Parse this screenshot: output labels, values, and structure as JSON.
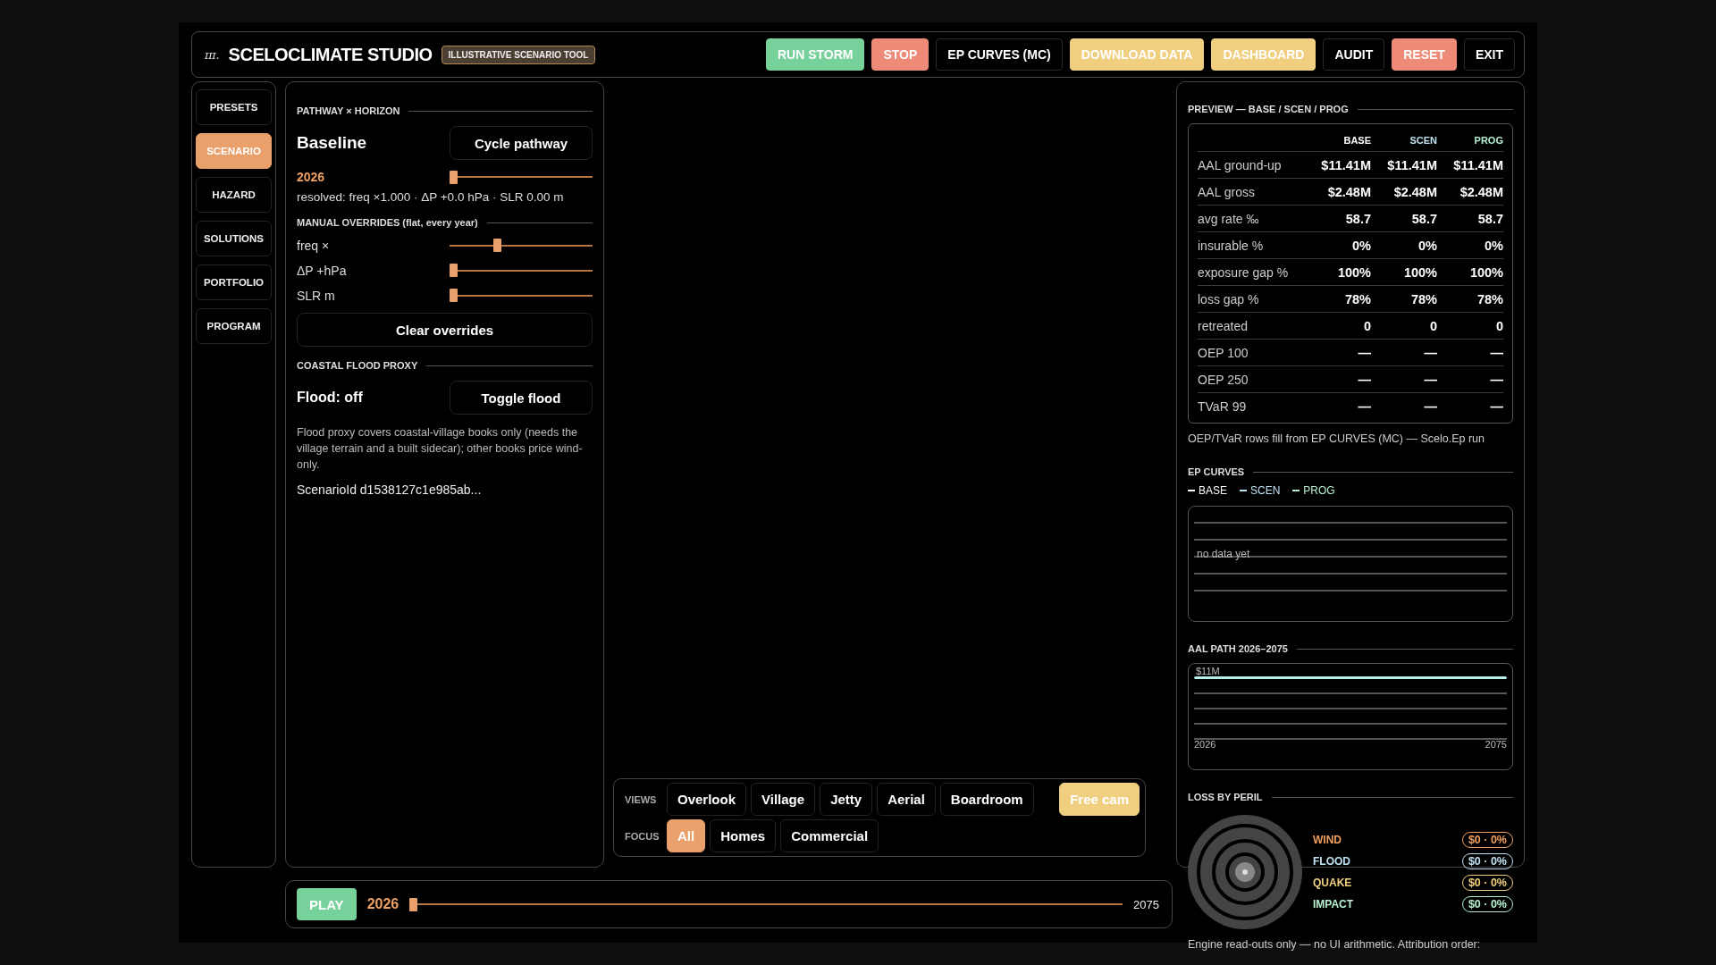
{
  "app": {
    "logo": "ɪɪɪ.",
    "title": "SCELOCLIMATE STUDIO",
    "badge": "ILLUSTRATIVE SCENARIO TOOL"
  },
  "toolbar": [
    {
      "label": "RUN STORM",
      "kind": "green"
    },
    {
      "label": "STOP",
      "kind": "red"
    },
    {
      "label": "EP CURVES (MC)",
      "kind": "plain"
    },
    {
      "label": "DOWNLOAD DATA",
      "kind": "yellow"
    },
    {
      "label": "DASHBOARD",
      "kind": "yellow"
    },
    {
      "label": "AUDIT",
      "kind": "plain"
    },
    {
      "label": "RESET",
      "kind": "red"
    },
    {
      "label": "EXIT",
      "kind": "plain"
    }
  ],
  "nav": [
    {
      "label": "PRESETS",
      "selected": false
    },
    {
      "label": "SCENARIO",
      "selected": true
    },
    {
      "label": "HAZARD",
      "selected": false
    },
    {
      "label": "SOLUTIONS",
      "selected": false
    },
    {
      "label": "PORTFOLIO",
      "selected": false
    },
    {
      "label": "PROGRAM",
      "selected": false
    }
  ],
  "scenario": {
    "pathway_heading": "PATHWAY × HORIZON",
    "pathway": "Baseline",
    "cycle_button": "Cycle pathway",
    "year": "2026",
    "year_slider": {
      "level": 0
    },
    "resolved": "resolved: freq ×1.000 · ΔP +0.0 hPa · SLR 0.00 m",
    "overrides_heading": "MANUAL OVERRIDES (flat, every year)",
    "overrides": [
      {
        "label": "freq ×",
        "level": 0.33
      },
      {
        "label": "ΔP +hPa",
        "level": 0
      },
      {
        "label": "SLR m",
        "level": 0
      }
    ],
    "clear_button": "Clear overrides",
    "flood_heading": "COASTAL FLOOD PROXY",
    "flood_status": "Flood: off",
    "toggle_button": "Toggle flood",
    "flood_note": "Flood proxy covers coastal-village books only (needs the village terrain and a built sidecar); other books price wind-only.",
    "scenario_id": "ScenarioId d1538127c1e985ab..."
  },
  "views": {
    "label": "VIEWS",
    "items": [
      {
        "label": "Overlook",
        "selected": false
      },
      {
        "label": "Village",
        "selected": false
      },
      {
        "label": "Jetty",
        "selected": false
      },
      {
        "label": "Aerial",
        "selected": false
      },
      {
        "label": "Boardroom",
        "selected": false
      },
      {
        "label": "Free cam",
        "selected": true
      }
    ]
  },
  "focus": {
    "label": "FOCUS",
    "items": [
      {
        "label": "All",
        "selected": true
      },
      {
        "label": "Homes",
        "selected": false
      },
      {
        "label": "Commercial",
        "selected": false
      }
    ]
  },
  "timeline": {
    "play_button": "PLAY",
    "year": "2026",
    "level": 0,
    "end": "2075"
  },
  "preview": {
    "heading": "PREVIEW — BASE / SCEN / PROG",
    "columns": [
      {
        "label": "BASE",
        "color": "#ffffff"
      },
      {
        "label": "SCEN",
        "color": "#bfe2f2"
      },
      {
        "label": "PROG",
        "color": "#b6f0cf"
      }
    ],
    "rows": [
      {
        "label": "AAL ground-up",
        "values": [
          "$11.41M",
          "$11.41M",
          "$11.41M"
        ]
      },
      {
        "label": "AAL gross",
        "values": [
          "$2.48M",
          "$2.48M",
          "$2.48M"
        ]
      },
      {
        "label": "avg rate ‰",
        "values": [
          "58.7",
          "58.7",
          "58.7"
        ]
      },
      {
        "label": "insurable %",
        "values": [
          "0%",
          "0%",
          "0%"
        ]
      },
      {
        "label": "exposure gap %",
        "values": [
          "100%",
          "100%",
          "100%"
        ]
      },
      {
        "label": "loss gap %",
        "values": [
          "78%",
          "78%",
          "78%"
        ]
      },
      {
        "label": "retreated",
        "values": [
          "0",
          "0",
          "0"
        ]
      },
      {
        "label": "OEP 100",
        "values": [
          "—",
          "—",
          "—"
        ]
      },
      {
        "label": "OEP 250",
        "values": [
          "—",
          "—",
          "—"
        ]
      },
      {
        "label": "TVaR 99",
        "values": [
          "—",
          "—",
          "—"
        ]
      }
    ],
    "note": "OEP/TVaR rows fill from EP CURVES (MC) — Scelo.Ep run"
  },
  "ep_curves": {
    "heading": "EP CURVES",
    "legend": [
      {
        "label": "BASE",
        "color": "#ffffff"
      },
      {
        "label": "SCEN",
        "color": "#bfe2f2"
      },
      {
        "label": "PROG",
        "color": "#b6f0cf"
      }
    ],
    "empty_text": "no data yet"
  },
  "aal_path": {
    "heading": "AAL PATH 2026–2075",
    "value_label": "$11M",
    "start": "2026",
    "end": "2075"
  },
  "loss_by_peril": {
    "heading": "LOSS BY PERIL",
    "items": [
      {
        "label": "WIND",
        "value": "$0 · 0%",
        "color": "#f0a060"
      },
      {
        "label": "FLOOD",
        "value": "$0 · 0%",
        "color": "#bfe2f2"
      },
      {
        "label": "QUAKE",
        "value": "$0 · 0%",
        "color": "#f0cf7f"
      },
      {
        "label": "IMPACT",
        "value": "$0 · 0%",
        "color": "#b6f0cf"
      }
    ],
    "footer": "Engine read-outs only — no UI arithmetic. Attribution order:"
  }
}
